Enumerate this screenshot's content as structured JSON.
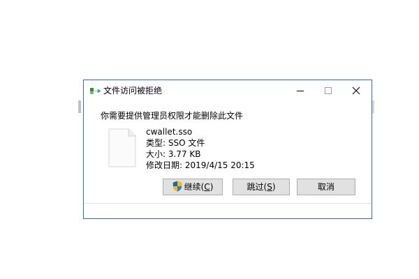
{
  "dialog": {
    "title": "文件访问被拒绝",
    "message": "你需要提供管理员权限才能删除此文件",
    "file": {
      "name": "cwallet.sso",
      "type_line": "类型: SSO 文件",
      "size_line": "大小: 3.77 KB",
      "modified_line": "修改日期: 2019/4/15 20:15"
    },
    "buttons": {
      "continue_label": "继续(",
      "continue_key": "C",
      "continue_end": ")",
      "skip_label": "跳过(",
      "skip_key": "S",
      "skip_end": ")",
      "cancel_label": "取消"
    },
    "icons": {
      "title": "file-transfer-icon",
      "file": "file-icon",
      "uac": "uac-shield-icon",
      "minimize": "minimize-icon",
      "maximize": "maximize-icon",
      "close": "close-icon"
    },
    "colors": {
      "border": "#2b6cd8",
      "button_bg": "#e1e1e1",
      "button_border": "#adadad"
    }
  }
}
